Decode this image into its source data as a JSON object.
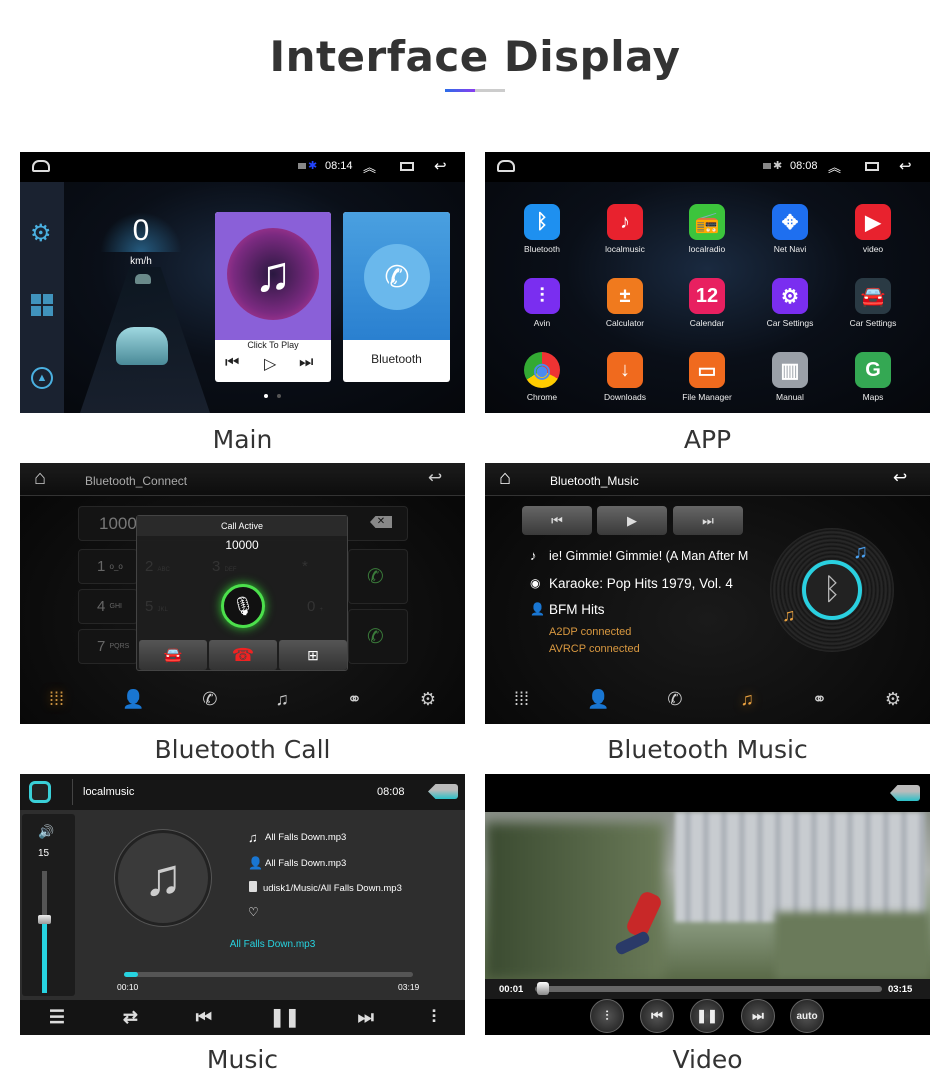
{
  "page": {
    "title": "Interface Display"
  },
  "captions": {
    "main": "Main",
    "app": "APP",
    "bt_call": "Bluetooth Call",
    "bt_music": "Bluetooth Music",
    "music": "Music",
    "video": "Video"
  },
  "main_screen": {
    "time": "08:14",
    "speed": "0",
    "speed_unit": "km/h",
    "music_card": {
      "label": "Click To Play"
    },
    "bluetooth_card": {
      "label": "Bluetooth"
    }
  },
  "app_screen": {
    "time": "08:08",
    "apps": [
      {
        "label": "Bluetooth",
        "icon": "bluetooth-icon",
        "color": "#1e90f0"
      },
      {
        "label": "localmusic",
        "icon": "music-note-icon",
        "color": "#e8222e"
      },
      {
        "label": "localradio",
        "icon": "radio-icon",
        "color": "#3cc43c"
      },
      {
        "label": "Net Navi",
        "icon": "compass-icon",
        "color": "#1e6ff0"
      },
      {
        "label": "video",
        "icon": "play-icon",
        "color": "#e8222e"
      },
      {
        "label": "Avin",
        "icon": "equalizer-icon",
        "color": "#7a2ef0"
      },
      {
        "label": "Calculator",
        "icon": "calculator-icon",
        "color": "#f07a1e"
      },
      {
        "label": "Calendar",
        "icon": "calendar-icon",
        "color": "#e82060"
      },
      {
        "label": "Car Settings",
        "icon": "gear-icon",
        "color": "#7a2ef0"
      },
      {
        "label": "Car Settings",
        "icon": "car-icon",
        "color": "#2a3a44"
      },
      {
        "label": "Chrome",
        "icon": "chrome-icon",
        "color": "#dddddd"
      },
      {
        "label": "Downloads",
        "icon": "download-icon",
        "color": "#f06a1e"
      },
      {
        "label": "File Manager",
        "icon": "folder-icon",
        "color": "#f06a1e"
      },
      {
        "label": "Manual",
        "icon": "book-icon",
        "color": "#9aa0a8"
      },
      {
        "label": "Maps",
        "icon": "maps-icon",
        "color": "#34a853"
      }
    ]
  },
  "bt_call": {
    "header": "Bluetooth_Connect",
    "dial_value": "10000",
    "keys": [
      {
        "d": "1",
        "s": "ᴏ_ᴏ"
      },
      {
        "d": "2",
        "s": "ABC"
      },
      {
        "d": "3",
        "s": "DEF"
      },
      {
        "d": "*",
        "s": ""
      },
      {
        "d": "4",
        "s": "GHI"
      },
      {
        "d": "5",
        "s": "JKL"
      },
      {
        "d": "0",
        "s": "+"
      },
      {
        "d": "7",
        "s": "PQRS"
      }
    ],
    "popup": {
      "title": "Call Active",
      "number": "10000"
    }
  },
  "bt_music": {
    "header": "Bluetooth_Music",
    "track": "ie! Gimmie! Gimmie! (A Man After M",
    "album": "Karaoke: Pop Hits 1979, Vol. 4",
    "artist": "BFM Hits",
    "status1": "A2DP connected",
    "status2": "AVRCP connected",
    "accent": "#e8a040"
  },
  "music": {
    "header": "localmusic",
    "time": "08:08",
    "volume": "15",
    "volume_level": 0.6,
    "title": "All Falls Down.mp3",
    "artist": "All Falls Down.mp3",
    "path": "udisk1/Music/All Falls Down.mp3",
    "now_playing": "All Falls Down.mp3",
    "elapsed": "00:10",
    "duration": "03:19",
    "progress": 0.05,
    "accent": "#27d3e0"
  },
  "video": {
    "elapsed": "00:01",
    "duration": "03:15",
    "progress": 0.005,
    "auto_label": "auto"
  }
}
